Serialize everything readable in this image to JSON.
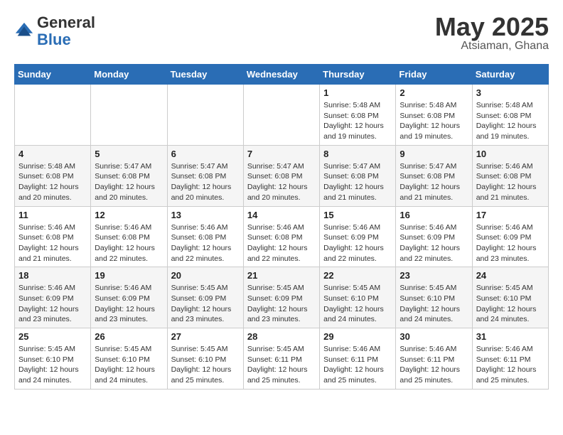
{
  "logo": {
    "general": "General",
    "blue": "Blue"
  },
  "title": {
    "month": "May 2025",
    "location": "Atsiaman, Ghana"
  },
  "days_header": [
    "Sunday",
    "Monday",
    "Tuesday",
    "Wednesday",
    "Thursday",
    "Friday",
    "Saturday"
  ],
  "weeks": [
    [
      {
        "day": "",
        "info": ""
      },
      {
        "day": "",
        "info": ""
      },
      {
        "day": "",
        "info": ""
      },
      {
        "day": "",
        "info": ""
      },
      {
        "day": "1",
        "info": "Sunrise: 5:48 AM\nSunset: 6:08 PM\nDaylight: 12 hours\nand 19 minutes."
      },
      {
        "day": "2",
        "info": "Sunrise: 5:48 AM\nSunset: 6:08 PM\nDaylight: 12 hours\nand 19 minutes."
      },
      {
        "day": "3",
        "info": "Sunrise: 5:48 AM\nSunset: 6:08 PM\nDaylight: 12 hours\nand 19 minutes."
      }
    ],
    [
      {
        "day": "4",
        "info": "Sunrise: 5:48 AM\nSunset: 6:08 PM\nDaylight: 12 hours\nand 20 minutes."
      },
      {
        "day": "5",
        "info": "Sunrise: 5:47 AM\nSunset: 6:08 PM\nDaylight: 12 hours\nand 20 minutes."
      },
      {
        "day": "6",
        "info": "Sunrise: 5:47 AM\nSunset: 6:08 PM\nDaylight: 12 hours\nand 20 minutes."
      },
      {
        "day": "7",
        "info": "Sunrise: 5:47 AM\nSunset: 6:08 PM\nDaylight: 12 hours\nand 20 minutes."
      },
      {
        "day": "8",
        "info": "Sunrise: 5:47 AM\nSunset: 6:08 PM\nDaylight: 12 hours\nand 21 minutes."
      },
      {
        "day": "9",
        "info": "Sunrise: 5:47 AM\nSunset: 6:08 PM\nDaylight: 12 hours\nand 21 minutes."
      },
      {
        "day": "10",
        "info": "Sunrise: 5:46 AM\nSunset: 6:08 PM\nDaylight: 12 hours\nand 21 minutes."
      }
    ],
    [
      {
        "day": "11",
        "info": "Sunrise: 5:46 AM\nSunset: 6:08 PM\nDaylight: 12 hours\nand 21 minutes."
      },
      {
        "day": "12",
        "info": "Sunrise: 5:46 AM\nSunset: 6:08 PM\nDaylight: 12 hours\nand 22 minutes."
      },
      {
        "day": "13",
        "info": "Sunrise: 5:46 AM\nSunset: 6:08 PM\nDaylight: 12 hours\nand 22 minutes."
      },
      {
        "day": "14",
        "info": "Sunrise: 5:46 AM\nSunset: 6:08 PM\nDaylight: 12 hours\nand 22 minutes."
      },
      {
        "day": "15",
        "info": "Sunrise: 5:46 AM\nSunset: 6:09 PM\nDaylight: 12 hours\nand 22 minutes."
      },
      {
        "day": "16",
        "info": "Sunrise: 5:46 AM\nSunset: 6:09 PM\nDaylight: 12 hours\nand 22 minutes."
      },
      {
        "day": "17",
        "info": "Sunrise: 5:46 AM\nSunset: 6:09 PM\nDaylight: 12 hours\nand 23 minutes."
      }
    ],
    [
      {
        "day": "18",
        "info": "Sunrise: 5:46 AM\nSunset: 6:09 PM\nDaylight: 12 hours\nand 23 minutes."
      },
      {
        "day": "19",
        "info": "Sunrise: 5:46 AM\nSunset: 6:09 PM\nDaylight: 12 hours\nand 23 minutes."
      },
      {
        "day": "20",
        "info": "Sunrise: 5:45 AM\nSunset: 6:09 PM\nDaylight: 12 hours\nand 23 minutes."
      },
      {
        "day": "21",
        "info": "Sunrise: 5:45 AM\nSunset: 6:09 PM\nDaylight: 12 hours\nand 23 minutes."
      },
      {
        "day": "22",
        "info": "Sunrise: 5:45 AM\nSunset: 6:10 PM\nDaylight: 12 hours\nand 24 minutes."
      },
      {
        "day": "23",
        "info": "Sunrise: 5:45 AM\nSunset: 6:10 PM\nDaylight: 12 hours\nand 24 minutes."
      },
      {
        "day": "24",
        "info": "Sunrise: 5:45 AM\nSunset: 6:10 PM\nDaylight: 12 hours\nand 24 minutes."
      }
    ],
    [
      {
        "day": "25",
        "info": "Sunrise: 5:45 AM\nSunset: 6:10 PM\nDaylight: 12 hours\nand 24 minutes."
      },
      {
        "day": "26",
        "info": "Sunrise: 5:45 AM\nSunset: 6:10 PM\nDaylight: 12 hours\nand 24 minutes."
      },
      {
        "day": "27",
        "info": "Sunrise: 5:45 AM\nSunset: 6:10 PM\nDaylight: 12 hours\nand 25 minutes."
      },
      {
        "day": "28",
        "info": "Sunrise: 5:45 AM\nSunset: 6:11 PM\nDaylight: 12 hours\nand 25 minutes."
      },
      {
        "day": "29",
        "info": "Sunrise: 5:46 AM\nSunset: 6:11 PM\nDaylight: 12 hours\nand 25 minutes."
      },
      {
        "day": "30",
        "info": "Sunrise: 5:46 AM\nSunset: 6:11 PM\nDaylight: 12 hours\nand 25 minutes."
      },
      {
        "day": "31",
        "info": "Sunrise: 5:46 AM\nSunset: 6:11 PM\nDaylight: 12 hours\nand 25 minutes."
      }
    ]
  ]
}
